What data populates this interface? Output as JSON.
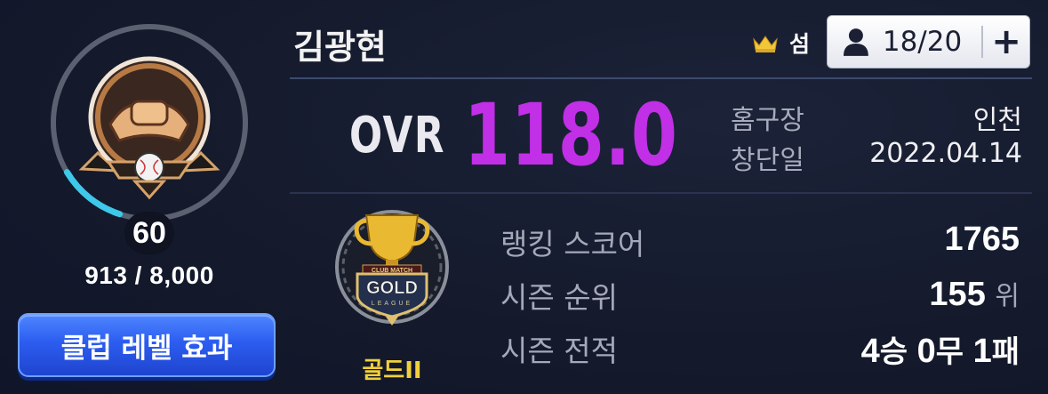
{
  "club": {
    "name": "김광현",
    "level": "60",
    "xp_text": "913 / 8,000",
    "xp_progress": 0.114,
    "effect_button_label": "클럽 레벨 효과"
  },
  "header": {
    "role_label": "섬",
    "member_count": "18/20",
    "add_label": "+"
  },
  "ovr": {
    "label": "OVR",
    "value": "118.0"
  },
  "info": {
    "home_label": "홈구장",
    "home_value": "인천",
    "founded_label": "창단일",
    "founded_value": "2022.04.14"
  },
  "league": {
    "name": "골드II",
    "emblem_top_text": "CLUB MATCH",
    "emblem_main_text": "GOLD",
    "emblem_sub_text": "LEAGUE"
  },
  "stats": {
    "ranking_label": "랭킹 스코어",
    "ranking_value": "1765",
    "season_rank_label": "시즌 순위",
    "season_rank_value": "155",
    "season_rank_unit": "위",
    "record_label": "시즌 전적",
    "record": {
      "wins": "4",
      "wins_unit": "승",
      "draws": "0",
      "draws_unit": "무",
      "losses": "1",
      "losses_unit": "패"
    }
  },
  "colors": {
    "ovr": "#c12fe6",
    "league_name": "#f2d03a",
    "xp_progress": "#3ec8ea",
    "button": "#2c5df0"
  }
}
